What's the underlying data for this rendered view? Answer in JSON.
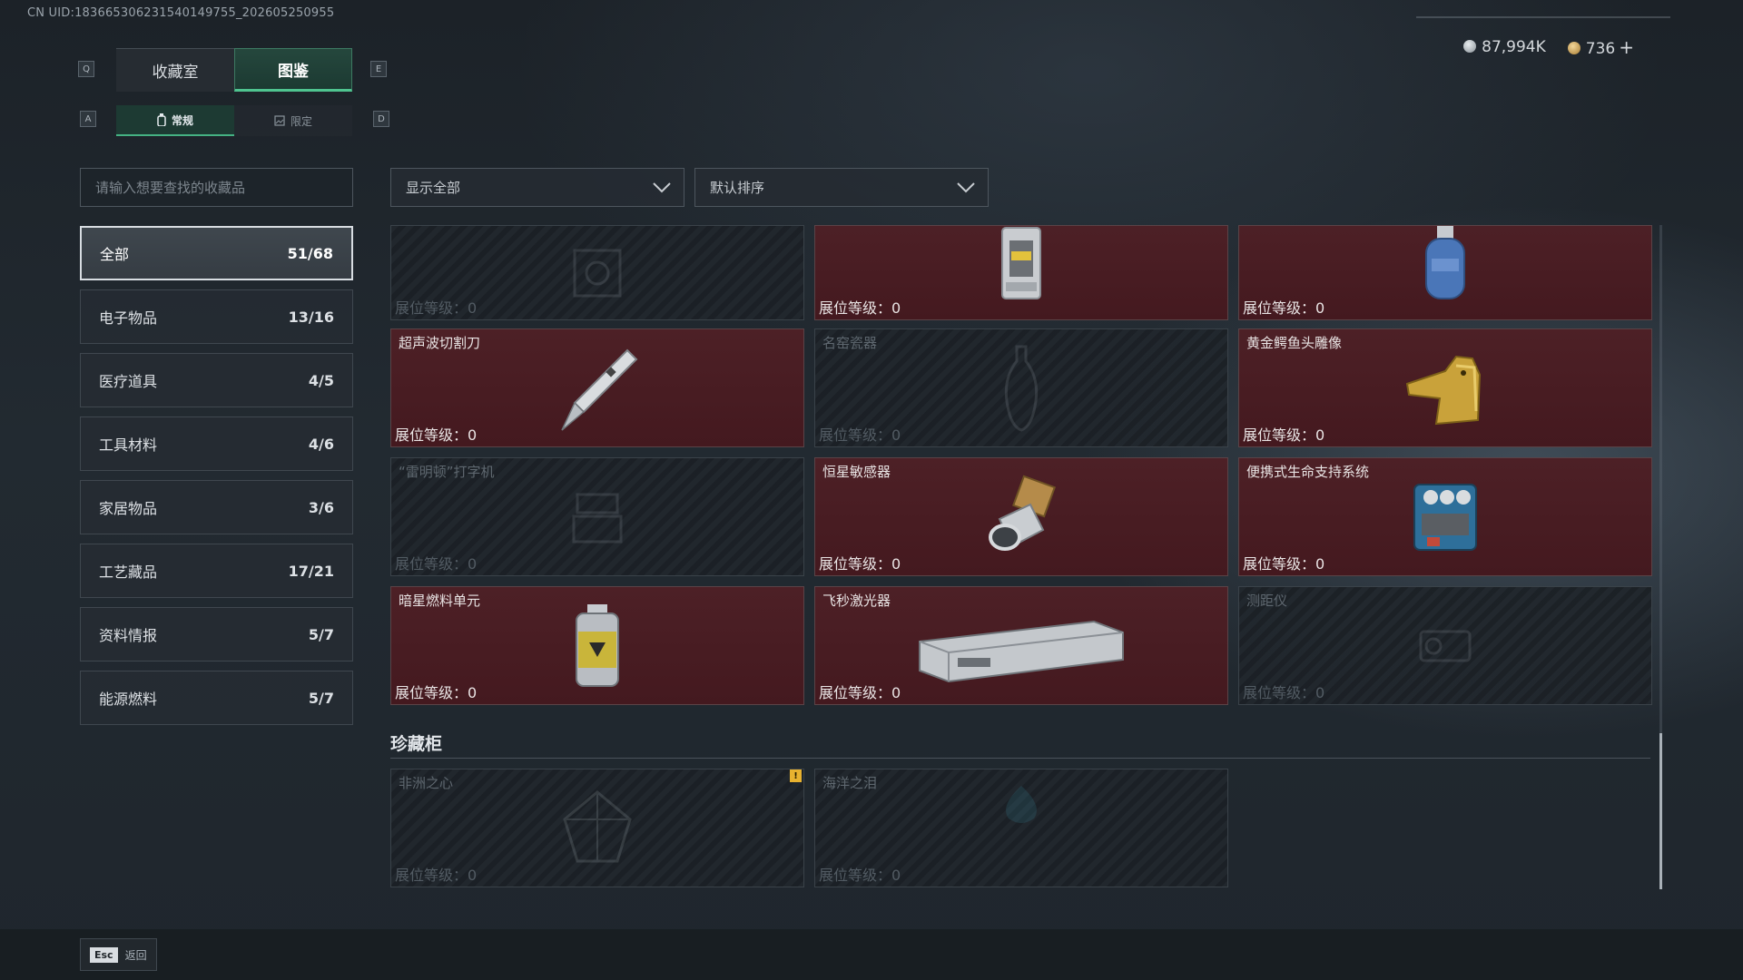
{
  "uid": "CN UID:18366530623154014975​5_202605250955",
  "keys": {
    "prev_tab": "Q",
    "next_tab": "E",
    "prev_sub": "A",
    "next_sub": "D"
  },
  "tabs": [
    {
      "label": "收藏室"
    },
    {
      "label": "图鉴"
    }
  ],
  "subtabs": [
    {
      "label": "常规"
    },
    {
      "label": "限定"
    }
  ],
  "currency": {
    "silver": "87,994K",
    "gold": "736",
    "plus": "+"
  },
  "search": {
    "placeholder": "请输入想要查找的收藏品"
  },
  "categories": [
    {
      "label": "全部",
      "count": "51/68"
    },
    {
      "label": "电子物品",
      "count": "13/16"
    },
    {
      "label": "医疗道具",
      "count": "4/5"
    },
    {
      "label": "工具材料",
      "count": "4/6"
    },
    {
      "label": "家居物品",
      "count": "3/6"
    },
    {
      "label": "工艺藏品",
      "count": "17/21"
    },
    {
      "label": "资料情报",
      "count": "5/7"
    },
    {
      "label": "能源燃料",
      "count": "5/7"
    }
  ],
  "filters": {
    "show": "显示全部",
    "sort": "默认排序"
  },
  "level_label": "展位等级：",
  "items": [
    {
      "name": "",
      "level": "0",
      "owned": false,
      "icon": "machine-icon"
    },
    {
      "name": "",
      "level": "0",
      "owned": true,
      "icon": "lantern-device-icon"
    },
    {
      "name": "",
      "level": "0",
      "owned": true,
      "icon": "gas-canister-icon"
    },
    {
      "name": "超声波切割刀",
      "level": "0",
      "owned": true,
      "icon": "ultrasonic-knife-icon"
    },
    {
      "name": "名窑瓷器",
      "level": "0",
      "owned": false,
      "icon": "vase-icon"
    },
    {
      "name": "黄金鳄鱼头雕像",
      "level": "0",
      "owned": true,
      "icon": "golden-crocodile-icon"
    },
    {
      "name": "“雷明顿”打字机",
      "level": "0",
      "owned": false,
      "icon": "typewriter-icon"
    },
    {
      "name": "恒星敏感器",
      "level": "0",
      "owned": true,
      "icon": "star-sensor-icon"
    },
    {
      "name": "便携式生命支持系统",
      "level": "0",
      "owned": true,
      "icon": "life-support-icon"
    },
    {
      "name": "暗星燃料单元",
      "level": "0",
      "owned": true,
      "icon": "fuel-cell-icon"
    },
    {
      "name": "飞秒激光器",
      "level": "0",
      "owned": true,
      "icon": "femtosecond-laser-icon"
    },
    {
      "name": "测距仪",
      "level": "0",
      "owned": false,
      "icon": "rangefinder-icon"
    }
  ],
  "cabinet": {
    "title": "珍藏柜",
    "items": [
      {
        "name": "非洲之心",
        "level": "0",
        "owned": false,
        "warning": "!",
        "icon": "heart-of-africa-icon"
      },
      {
        "name": "海洋之泪",
        "level": "0",
        "owned": false,
        "icon": "ocean-tear-icon"
      }
    ]
  },
  "footer": {
    "esc_key": "Esc",
    "esc_label": "返回"
  }
}
